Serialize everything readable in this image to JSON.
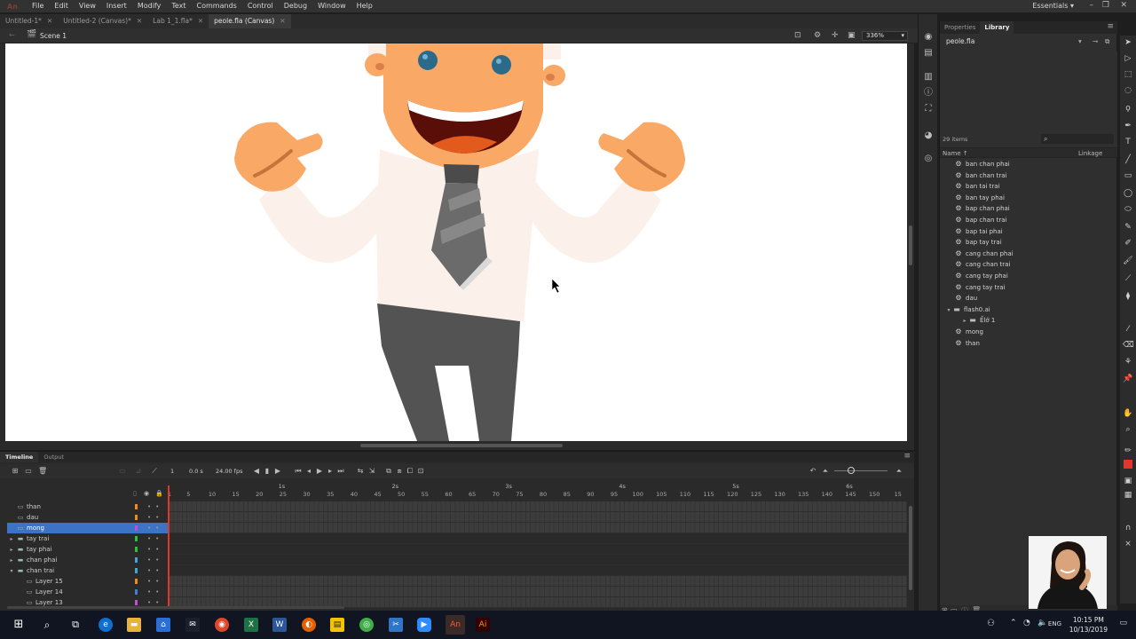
{
  "menubar": {
    "logo": "An",
    "items": [
      "File",
      "Edit",
      "View",
      "Insert",
      "Modify",
      "Text",
      "Commands",
      "Control",
      "Debug",
      "Window",
      "Help"
    ],
    "workspace": "Essentials",
    "workspace_chevron": "▾"
  },
  "doc_tabs": [
    {
      "label": "Untitled-1*",
      "active": false
    },
    {
      "label": "Untitled-2 (Canvas)*",
      "active": false
    },
    {
      "label": "Lab 1_1.fla*",
      "active": false
    },
    {
      "label": "peole.fla (Canvas)",
      "active": true
    }
  ],
  "editbar": {
    "scene": "Scene 1",
    "zoom": "336%"
  },
  "panel": {
    "tabs": [
      "Properties",
      "Library"
    ],
    "active_tab": "Library",
    "library_file": "peole.fla",
    "item_count": "29 items",
    "columns": {
      "name": "Name ↑",
      "linkage": "Linkage"
    },
    "items": [
      {
        "label": "ban chan phai",
        "type": "symbol",
        "indent": 1
      },
      {
        "label": "ban chan trai",
        "type": "symbol",
        "indent": 1
      },
      {
        "label": "ban tai trai",
        "type": "symbol",
        "indent": 1
      },
      {
        "label": "ban tay phai",
        "type": "symbol",
        "indent": 1
      },
      {
        "label": "bap chan phai",
        "type": "symbol",
        "indent": 1
      },
      {
        "label": "bap chan trai",
        "type": "symbol",
        "indent": 1
      },
      {
        "label": "bap tai phai",
        "type": "symbol",
        "indent": 1
      },
      {
        "label": "bap tay trai",
        "type": "symbol",
        "indent": 1
      },
      {
        "label": "cang chan phai",
        "type": "symbol",
        "indent": 1
      },
      {
        "label": "cang chan trai",
        "type": "symbol",
        "indent": 1
      },
      {
        "label": "cang tay phai",
        "type": "symbol",
        "indent": 1
      },
      {
        "label": "cang tay trai",
        "type": "symbol",
        "indent": 1
      },
      {
        "label": "dau",
        "type": "symbol",
        "indent": 1
      },
      {
        "label": "flash0.ai",
        "type": "folder-open",
        "indent": 0
      },
      {
        "label": "Ếlớ 1",
        "type": "folder",
        "indent": 2
      },
      {
        "label": "mong",
        "type": "symbol",
        "indent": 1
      },
      {
        "label": "than",
        "type": "symbol",
        "indent": 1
      }
    ]
  },
  "timeline": {
    "tabs": [
      "Timeline",
      "Output"
    ],
    "current_frame": "1",
    "time": "0.0 s",
    "fps": "24.00 fps",
    "seconds": [
      {
        "label": "1s",
        "frame": 24
      },
      {
        "label": "2s",
        "frame": 48
      },
      {
        "label": "3s",
        "frame": 72
      },
      {
        "label": "4s",
        "frame": 96
      },
      {
        "label": "5s",
        "frame": 120
      },
      {
        "label": "6s",
        "frame": 144
      }
    ],
    "frame_ticks": [
      "1",
      "5",
      "10",
      "15",
      "20",
      "25",
      "30",
      "35",
      "40",
      "45",
      "50",
      "55",
      "60",
      "65",
      "70",
      "75",
      "80",
      "85",
      "90",
      "95",
      "100",
      "105",
      "110",
      "115",
      "120",
      "125",
      "130",
      "135",
      "140",
      "145",
      "150",
      "15"
    ],
    "layers": [
      {
        "name": "than",
        "kind": "layer",
        "color": "#f08a1c",
        "selected": false,
        "filled": true
      },
      {
        "name": "dau",
        "kind": "layer",
        "color": "#f08a1c",
        "selected": false,
        "filled": true
      },
      {
        "name": "mong",
        "kind": "layer",
        "color": "#c44dd6",
        "selected": true,
        "filled": true
      },
      {
        "name": "tay trai",
        "kind": "folder",
        "color": "#2fbf3f",
        "selected": false,
        "filled": false
      },
      {
        "name": "tay phai",
        "kind": "folder",
        "color": "#2fbf3f",
        "selected": false,
        "filled": false
      },
      {
        "name": "chan phai",
        "kind": "folder",
        "color": "#3fa8d6",
        "selected": false,
        "filled": false
      },
      {
        "name": "chan trai",
        "kind": "folder-open",
        "color": "#3fa8d6",
        "selected": false,
        "filled": false
      },
      {
        "name": "Layer 15",
        "kind": "sublayer",
        "color": "#f08a1c",
        "selected": false,
        "filled": true
      },
      {
        "name": "Layer 14",
        "kind": "sublayer",
        "color": "#3f7fd6",
        "selected": false,
        "filled": true
      },
      {
        "name": "Layer 13",
        "kind": "sublayer",
        "color": "#c44dd6",
        "selected": false,
        "filled": true
      }
    ]
  },
  "taskbar": {
    "time": "10:15 PM",
    "date": "10/13/2019",
    "lang": "ENG"
  },
  "colors": {
    "accent_selected": "#3c73c4",
    "playhead": "#e0362b",
    "skin": "#f9a866",
    "shirt": "#fcf0eb",
    "pants": "#535353"
  }
}
